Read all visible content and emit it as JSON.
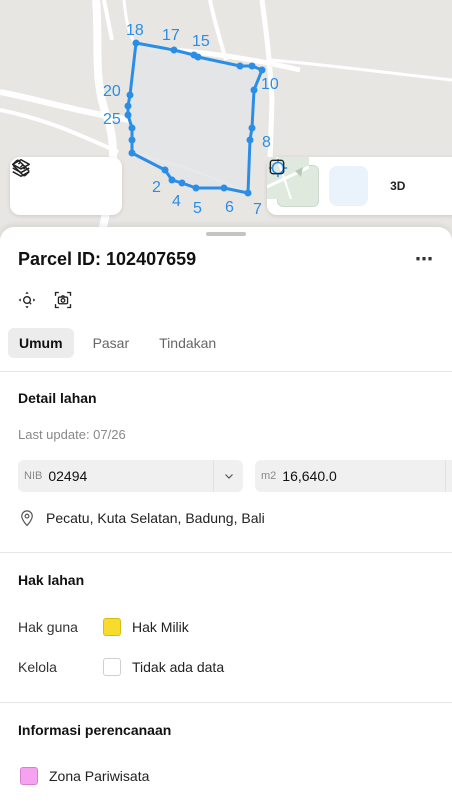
{
  "map": {
    "vertex_labels": [
      "18",
      "17",
      "15",
      "10",
      "8",
      "7",
      "6",
      "5",
      "4",
      "2",
      "25",
      "20"
    ],
    "colors": {
      "parcel_stroke": "#2a8ee6",
      "parcel_fill": "#e3e4e6",
      "map_bg": "#e8e6e3",
      "road": "#ffffff",
      "label": "#2a8ee6"
    },
    "toolbar_left": {
      "icons": [
        "layers-icon",
        "measure-icon"
      ]
    },
    "toolbar_right": {
      "icons": [
        "basemap-thumbnail",
        "locate-icon",
        "3d-toggle",
        "fullscreen-icon"
      ],
      "three_d_label": "3D"
    }
  },
  "sheet": {
    "title": "Parcel ID: 102407659",
    "more_label": "⋯",
    "tabs": [
      {
        "label": "Umum",
        "active": true
      },
      {
        "label": "Pasar",
        "active": false
      },
      {
        "label": "Tindakan",
        "active": false
      }
    ],
    "detail": {
      "heading": "Detail lahan",
      "last_update": "Last update: 07/26",
      "nib_prefix": "NIB",
      "nib_value": "02494",
      "area_prefix": "m2",
      "area_value": "16,640.0",
      "location": "Pecatu, Kuta Selatan, Badung, Bali"
    },
    "rights": {
      "heading": "Hak lahan",
      "rows": [
        {
          "label": "Hak guna",
          "value": "Hak Milik",
          "color": "#f7dc2e"
        },
        {
          "label": "Kelola",
          "value": "Tidak ada data",
          "color": "#ffffff"
        }
      ]
    },
    "planning": {
      "heading": "Informasi perencanaan",
      "zone": "Zona Pariwisata",
      "zone_color": "#f6a2f0"
    }
  }
}
